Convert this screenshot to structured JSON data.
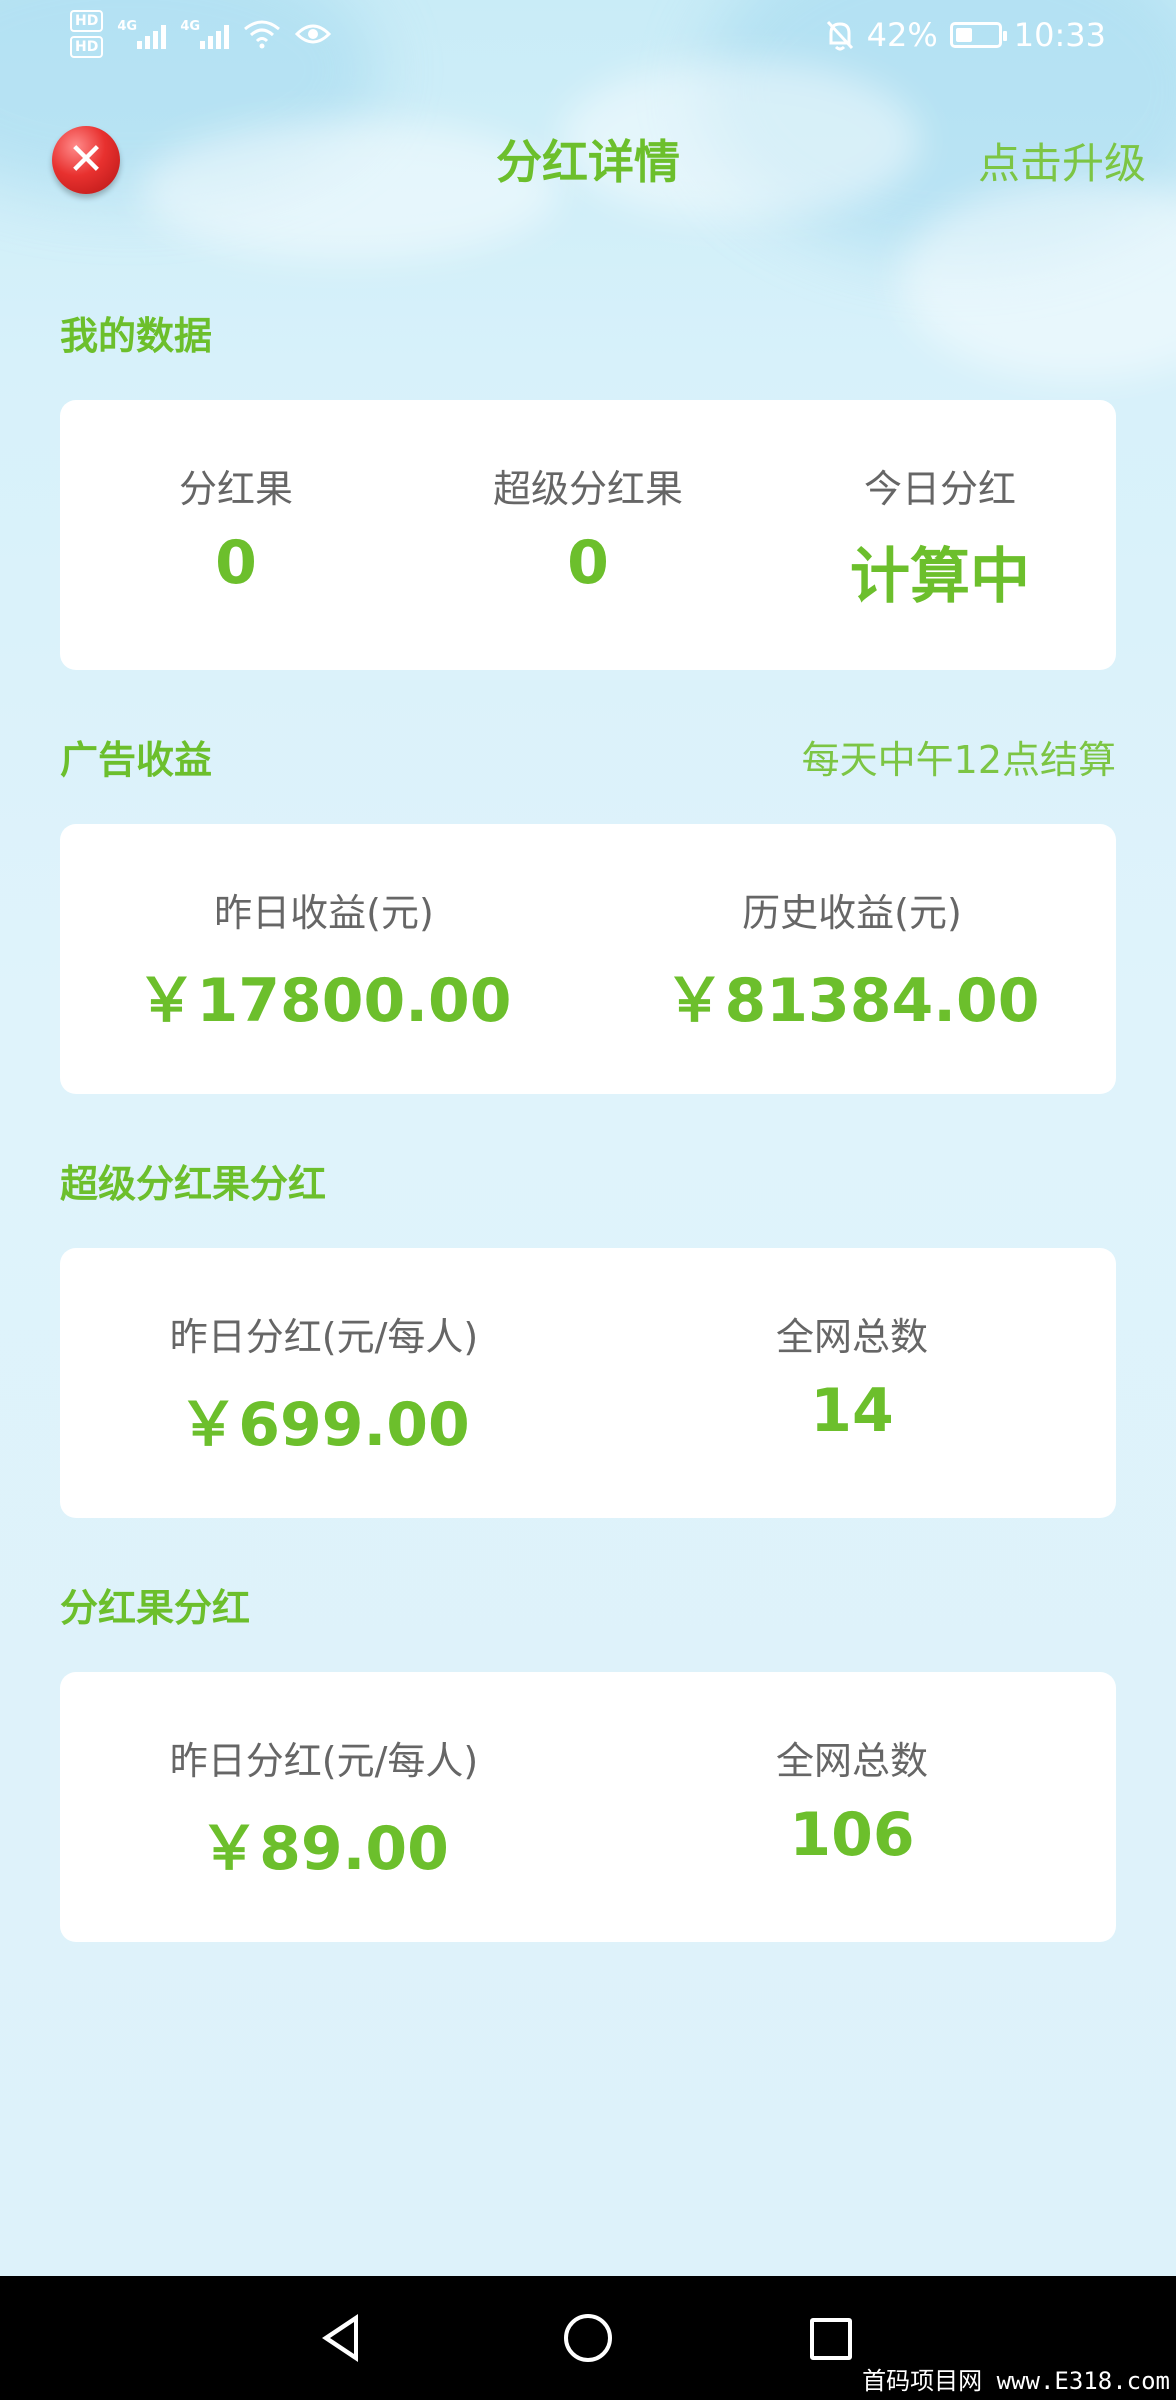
{
  "status_bar": {
    "hd1": "HD",
    "hd2": "HD",
    "net1": "4G",
    "net2": "4G",
    "battery": "42%",
    "time": "10:33"
  },
  "header": {
    "title": "分红详情",
    "upgrade": "点击升级"
  },
  "my_data": {
    "title": "我的数据",
    "items": [
      {
        "label": "分红果",
        "value": "0"
      },
      {
        "label": "超级分红果",
        "value": "0"
      },
      {
        "label": "今日分红",
        "value": "计算中"
      }
    ]
  },
  "ad_income": {
    "title": "广告收益",
    "note": "每天中午12点结算",
    "items": [
      {
        "label": "昨日收益(元)",
        "value": "￥17800.00"
      },
      {
        "label": "历史收益(元)",
        "value": "￥81384.00"
      }
    ]
  },
  "super_dividend": {
    "title": "超级分红果分红",
    "items": [
      {
        "label": "昨日分红(元/每人)",
        "value": "￥699.00"
      },
      {
        "label": "全网总数",
        "value": "14"
      }
    ]
  },
  "dividend": {
    "title": "分红果分红",
    "items": [
      {
        "label": "昨日分红(元/每人)",
        "value": "￥89.00"
      },
      {
        "label": "全网总数",
        "value": "106"
      }
    ]
  },
  "watermark": "首码项目网 www.E318.com",
  "colors": {
    "accent": "#6cbf2c",
    "label": "#666666",
    "background": "#ddf2fa",
    "close": "#e8312f"
  }
}
